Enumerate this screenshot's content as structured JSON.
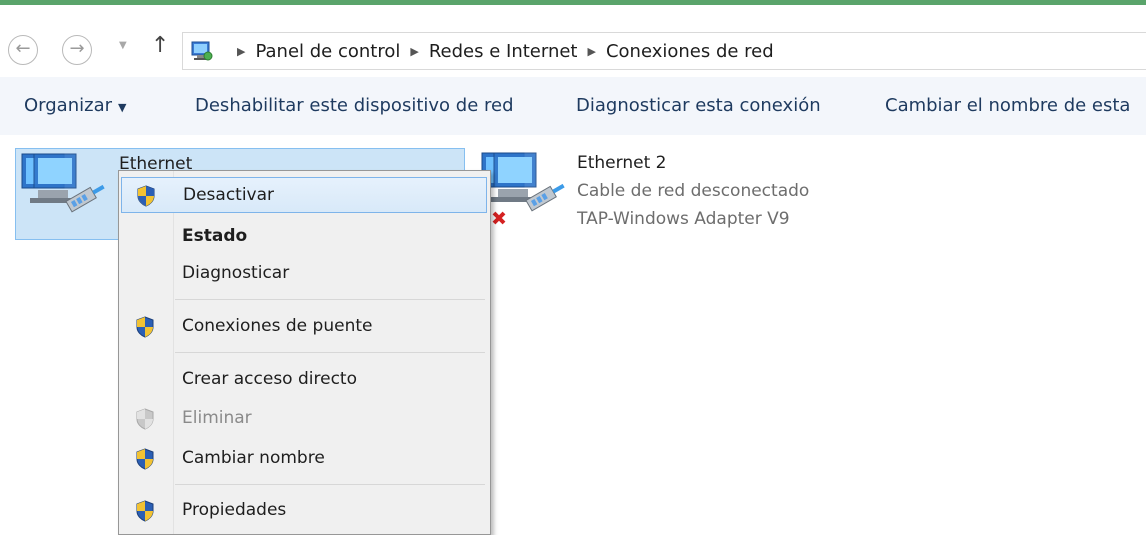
{
  "address_bar": {
    "breadcrumbs": [
      "Panel de control",
      "Redes e Internet",
      "Conexiones de red"
    ],
    "icons": [
      "back-arrow-icon",
      "forward-arrow-icon",
      "recent-locations-icon",
      "up-arrow-icon",
      "control-panel-icon"
    ]
  },
  "toolbar": {
    "organize": "Organizar",
    "disable": "Deshabilitar este dispositivo de red",
    "diagnose": "Diagnosticar esta conexión",
    "rename": "Cambiar el nombre de esta"
  },
  "adapters": [
    {
      "name": "Ethernet",
      "selected": true
    },
    {
      "name": "Ethernet 2",
      "status": "Cable de red desconectado",
      "device": "TAP-Windows Adapter V9",
      "disconnected": true
    }
  ],
  "context_menu": {
    "items": [
      {
        "label": "Desactivar",
        "shield": true,
        "highlighted": true
      },
      {
        "label": "Estado",
        "bold": true
      },
      {
        "label": "Diagnosticar"
      },
      {
        "label": "Conexiones de puente",
        "shield": true
      },
      {
        "label": "Crear acceso directo"
      },
      {
        "label": "Eliminar",
        "shield": true,
        "disabled": true
      },
      {
        "label": "Cambiar nombre",
        "shield": true
      },
      {
        "label": "Propiedades",
        "shield": true
      }
    ]
  },
  "colors": {
    "accent_bar": "#5aa46b",
    "selection": "#cce4f7",
    "toolbar_bg": "#f3f6fb"
  }
}
